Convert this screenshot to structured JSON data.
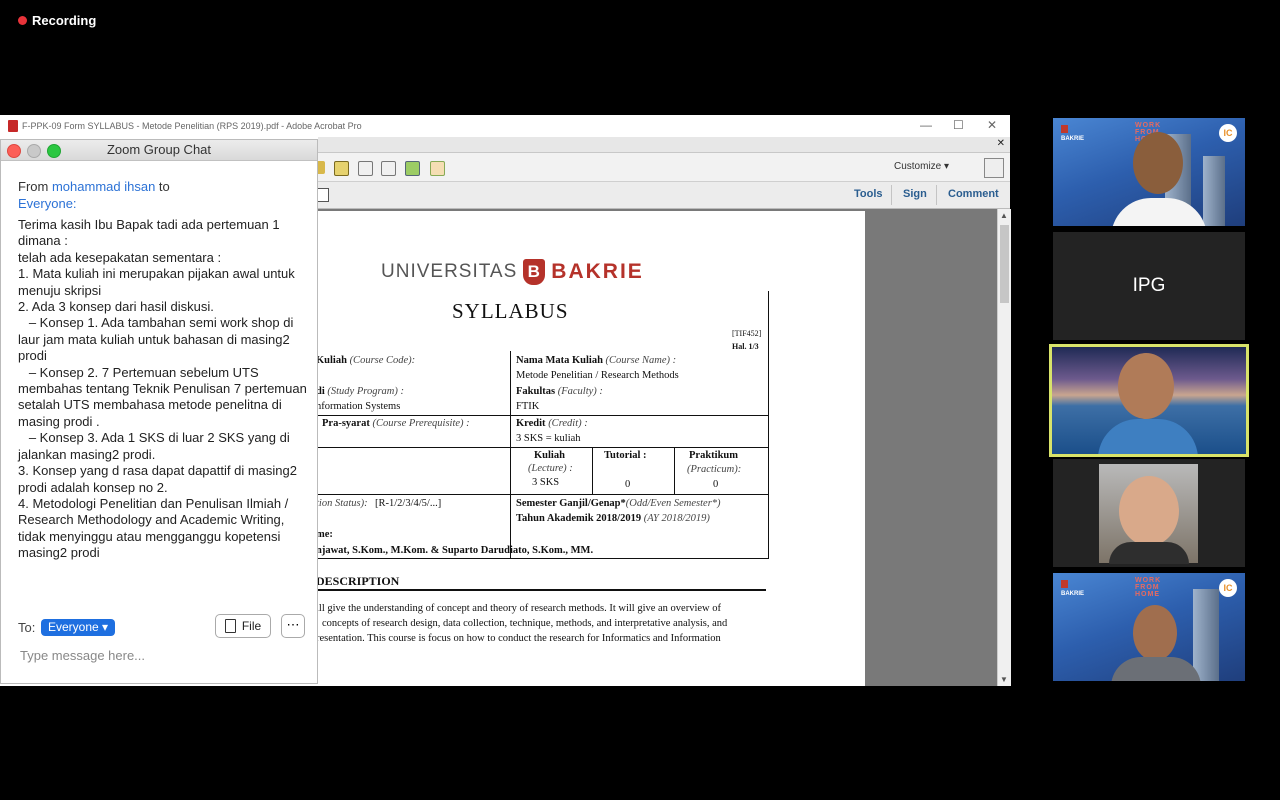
{
  "recording": {
    "label": "Recording"
  },
  "acrobat": {
    "window_title": "F-PPK-09 Form SYLLABUS - Metode Penelitian (RPS 2019).pdf - Adobe Acrobat Pro",
    "win_min": "—",
    "win_max": "☐",
    "win_close": "✕",
    "menu_close": "✕",
    "customize_label": "Customize",
    "nav": {
      "tools": "Tools",
      "sign": "Sign",
      "comment": "Comment"
    }
  },
  "pdf": {
    "logo_universitas": "UNIVERSITAS",
    "logo_shield": "B",
    "logo_bakrie": "BAKRIE",
    "title": "SYLLABUS",
    "code": "[TIF452]",
    "hal": "Hal. 1/3",
    "course_code_label": "Kuliah",
    "course_code_en": "(Course Code):",
    "course_name_label": "Nama Mata Kuliah",
    "course_name_en": "(Course Name) :",
    "course_name_value": "Metode Penelitian / Research Methods",
    "program_label": "di",
    "program_en": "(Study Program) :",
    "program_value": "nformation Systems",
    "faculty_label": "Fakultas",
    "faculty_en": "(Faculty) :",
    "faculty_value": "FTIK",
    "prereq_label": "Pra-syarat",
    "prereq_en": "(Course Prerequisite) :",
    "credit_label": "Kredit",
    "credit_en": "(Credit) :",
    "credit_value": "3 SKS = kuliah",
    "lecture_label": "Kuliah",
    "lecture_en": "(Lecture) :",
    "lecture_value": "3 SKS",
    "tutorial_label": "Tutorial :",
    "tutorial_value": "0",
    "practicum_label": "Praktikum",
    "practicum_en": "(Practicum):",
    "practicum_value": "0",
    "status_label": "tion Status):",
    "status_value": "[R-1/2/3/4/5/...]",
    "semester_label": "Semester Ganjil/Genap*",
    "semester_en": "(Odd/Even Semester*)",
    "year_label": "Tahun Akademik 2018/2019",
    "year_en": "(AY 2018/2019)",
    "lecturer_label": "me:",
    "lecturer_value": "njawat, S.Kom., M.Kom. & Suparto Darudiato, S.Kom., MM.",
    "desc_heading": "DESCRIPTION",
    "desc_line1": "ill give the understanding of concept and theory of research methods. It will give an overview of",
    "desc_line2": "concepts of research design, data collection, technique, methods, and interpretative analysis, and",
    "desc_line3": "resentation. This course is focus on how to conduct the research for Informatics and Information"
  },
  "chat": {
    "title": "Zoom Group Chat",
    "from_prefix": "From",
    "from_name": "mohammad ihsan",
    "from_to": "to",
    "recipient": "Everyone:",
    "message": "Terima kasih Ibu Bapak tadi ada pertemuan 1 dimana :\ntelah ada kesepakatan sementara :\n1. Mata kuliah ini merupakan pijakan awal untuk menuju skripsi\n2. Ada 3 konsep dari hasil diskusi.\n   – Konsep 1. Ada tambahan semi work shop di laur jam mata kuliah untuk bahasan di masing2 prodi\n   – Konsep 2. 7 Pertemuan sebelum UTS membahas tentang Teknik Penulisan 7 pertemuan setalah UTS membahasa metode penelitna di masing prodi .\n   – Konsep 3. Ada 1 SKS di luar 2 SKS yang di jalankan masing2 prodi.\n3. Konsep yang d rasa dapat dapattif di masing2 prodi adalah konsep no 2.\n4. Metodologi Penelitian dan Penulisan Ilmiah / Research Methodology and Academic Writing, tidak menyinggu atau mengganggu kopetensi masing2 prodi",
    "to_label": "To:",
    "to_value": "Everyone",
    "file_label": "File",
    "more_label": "⋯",
    "input_placeholder": "Type message here..."
  },
  "gallery": {
    "tile1_logo": "BAKRIE",
    "tile1_wfh": "WORK\nFROM\nHOME",
    "tile1_ic": "IC",
    "tile2_name": "IPG",
    "tile5_logo": "BAKRIE",
    "tile5_wfh": "WORK\nFROM\nHOME",
    "tile5_ic": "IC",
    "active_border_color": "#d8e36a"
  }
}
